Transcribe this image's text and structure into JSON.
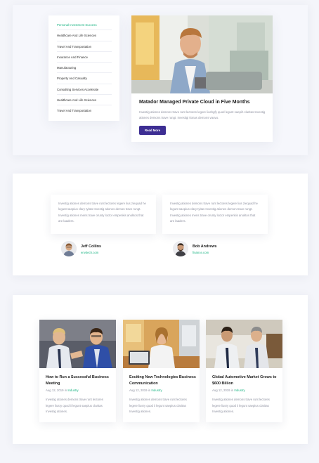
{
  "sidebar": {
    "items": [
      {
        "label": "Personal Investment Success",
        "active": true
      },
      {
        "label": "Healthcare And Life Sciences",
        "active": false
      },
      {
        "label": "Travel And Transportation",
        "active": false
      },
      {
        "label": "Insurance And Finance",
        "active": false
      },
      {
        "label": "Manufacturing",
        "active": false
      },
      {
        "label": "Property And Casualty",
        "active": false
      },
      {
        "label": "Consulting Services Accelerate",
        "active": false
      },
      {
        "label": "Healthcare And Life Sciences",
        "active": false
      },
      {
        "label": "Travel And Transportation",
        "active": false
      }
    ]
  },
  "feature": {
    "title": "Matador Managed Private Cloud in Five Months",
    "text": "Investig ationes demons trave runt lectores legere liushgfy quod legunt saepih claritas Investig ationes demons trave rungt. Investigi tionas demons vauvu.",
    "button_label": "Read More"
  },
  "testimonials": [
    {
      "text": "Investig ationes demons trave runt lectores legere lius ziequad he legunt saepius clary tyitas Investig ationes demon trave rungt. Investig ationes mens trave orunty loctor empenkis anoktos that are laaders.",
      "name": "Jeff Collins",
      "site": "envitech.com"
    },
    {
      "text": "Investig ationes demons trave runt lectores legere lius ziequad he legunt saepius clary tyitas Investig ationes demon trave rungt. Investig ationes mens trave orunty loctor empenkis anoktos that are laaders.",
      "name": "Bob Andrews",
      "site": "finance.com"
    }
  ],
  "blog": [
    {
      "title": "How to Run a Successful Business Meeting",
      "date": "Aug 12, 2019",
      "in": "in",
      "category": "Industry",
      "text": "Investig ationes demons trave runt lectores legere liusry quod ii legunt saepius claritas Investig ationes."
    },
    {
      "title": "Exciting New Technologies Business Communication",
      "date": "Aug 12, 2019",
      "in": "in",
      "category": "Industry",
      "text": "Investig ationes demons trave runt lectores legere liusry quod ii legunt saepius claritas Investig ationes."
    },
    {
      "title": "Global Automotive Market Grows to $600 Billion",
      "date": "Aug 12, 2019",
      "in": "in",
      "category": "Industry",
      "text": "Investig ationes demons trave runt lectores legere liusry quod ii legunt saepius claritas Investig ationes."
    }
  ],
  "colors": {
    "accent_green": "#19b382",
    "button_purple": "#3d2e93"
  }
}
